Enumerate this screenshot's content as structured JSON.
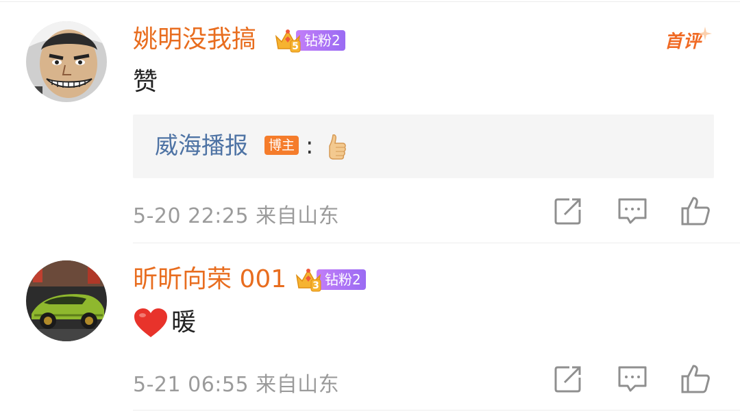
{
  "comments": [
    {
      "username": "姚明没我搞",
      "fan_badge": {
        "level": "5",
        "label": "钻粉2"
      },
      "first_comment_tag": "首评",
      "text": "赞",
      "reply": {
        "author": "威海播报",
        "author_tag": "博主",
        "separator": ":",
        "emoji": "thumbs-up"
      },
      "date": "5-20 22:25",
      "location": "来自山东",
      "avatar": "cartoon-face-avatar"
    },
    {
      "username": "昕昕向荣 001",
      "fan_badge": {
        "level": "3",
        "label": "钻粉2"
      },
      "emoji": "red-heart",
      "text": "暖",
      "date": "5-21 06:55",
      "location": "来自山东",
      "avatar": "green-car-avatar"
    }
  ],
  "icons": [
    "share-icon",
    "comment-icon",
    "like-icon"
  ],
  "colors": {
    "username": "#e86d1f",
    "reply_author": "#4e73a4",
    "meta_text": "#9b9b9b",
    "fan_badge": "#a870f5",
    "host_tag": "#f57c2b"
  }
}
